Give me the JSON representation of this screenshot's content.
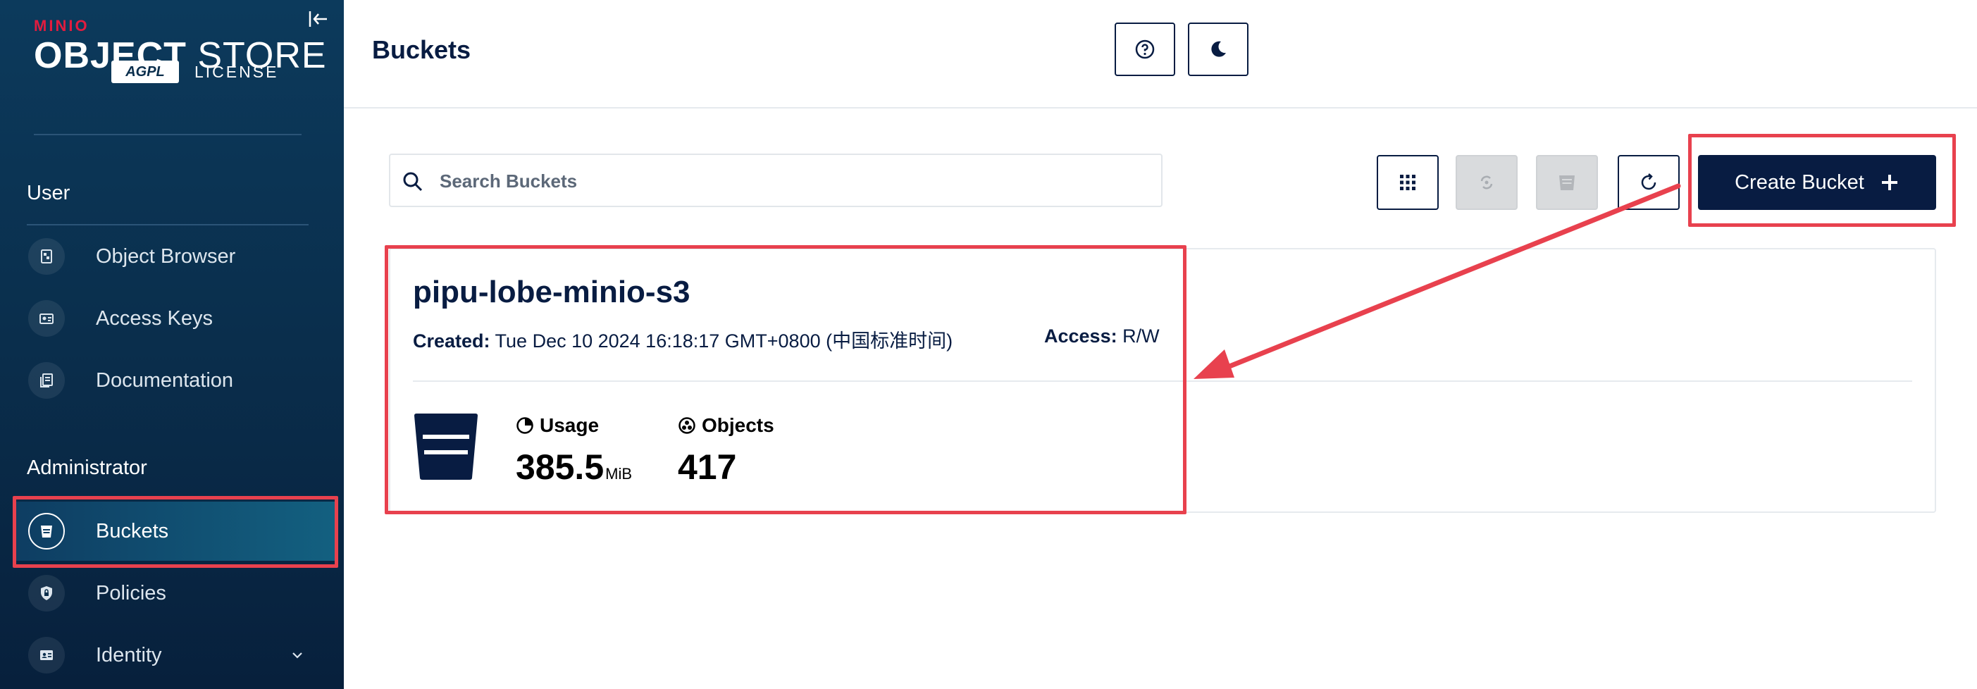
{
  "brand": {
    "vendor": "MINIO",
    "product_bold": "OBJECT",
    "product_light": "STORE",
    "license_badge": "AGPL",
    "license_text": "LICENSE"
  },
  "sidebar": {
    "sections": [
      {
        "label": "User"
      },
      {
        "label": "Administrator"
      }
    ],
    "user_items": [
      {
        "label": "Object Browser"
      },
      {
        "label": "Access Keys"
      },
      {
        "label": "Documentation"
      }
    ],
    "admin_items": [
      {
        "label": "Buckets",
        "active": true
      },
      {
        "label": "Policies"
      },
      {
        "label": "Identity"
      }
    ]
  },
  "header": {
    "title": "Buckets"
  },
  "toolbar": {
    "search_placeholder": "Search Buckets",
    "create_label": "Create Bucket"
  },
  "bucket": {
    "name": "pipu-lobe-minio-s3",
    "created_label": "Created:",
    "created_value": "Tue Dec 10 2024 16:18:17 GMT+0800 (中国标准时间)",
    "access_label": "Access:",
    "access_value": "R/W",
    "usage_label": "Usage",
    "usage_value": "385.5",
    "usage_unit": "MiB",
    "objects_label": "Objects",
    "objects_value": "417"
  },
  "colors": {
    "brand_navy": "#081c42",
    "sidebar_bg": "#0a2e4c",
    "annotation_red": "#e8414e",
    "minio_red": "#e21c3f"
  }
}
